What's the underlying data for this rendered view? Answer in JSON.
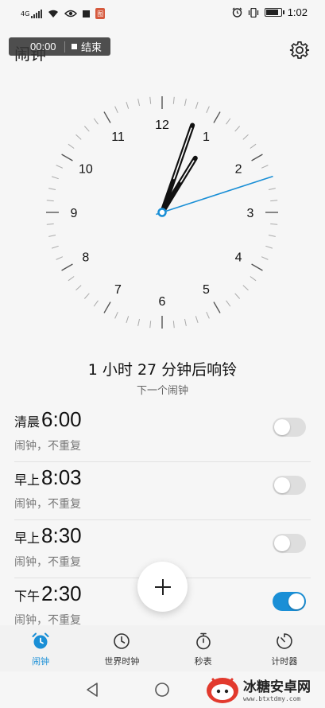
{
  "status_bar": {
    "network_label": "4G",
    "time": "1:02",
    "badge_text": "图"
  },
  "app": {
    "title": "闹钟"
  },
  "screen_record": {
    "elapsed": "00:00",
    "stop_label": "结束"
  },
  "clock": {
    "hour_numbers": [
      "12",
      "1",
      "2",
      "3",
      "4",
      "5",
      "6",
      "7",
      "8",
      "9",
      "10",
      "11"
    ],
    "hands": {
      "hour": 1,
      "minute": 3,
      "second": 12
    },
    "colors": {
      "hands": "#111111",
      "second_hand": "#1a8fd6"
    }
  },
  "next_alarm": {
    "countdown": "1 小时 27 分钟后响铃",
    "label": "下一个闹钟"
  },
  "alarms": [
    {
      "period": "清晨",
      "time": "6:00",
      "desc": "闹钟，不重复",
      "enabled": false
    },
    {
      "period": "早上",
      "time": "8:03",
      "desc": "闹钟，不重复",
      "enabled": false
    },
    {
      "period": "早上",
      "time": "8:30",
      "desc": "闹钟，不重复",
      "enabled": false
    },
    {
      "period": "下午",
      "time": "2:30",
      "desc": "闹钟，不重复",
      "enabled": true
    }
  ],
  "tabs": [
    {
      "label": "闹钟",
      "icon": "alarm-clock-icon",
      "active": true
    },
    {
      "label": "世界时钟",
      "icon": "world-clock-icon",
      "active": false
    },
    {
      "label": "秒表",
      "icon": "stopwatch-icon",
      "active": false
    },
    {
      "label": "计时器",
      "icon": "timer-icon",
      "active": false
    }
  ],
  "watermark": {
    "name": "冰糖安卓网",
    "url": "www.btxtdmy.com"
  },
  "theme": {
    "accent": "#1a8fd6"
  }
}
